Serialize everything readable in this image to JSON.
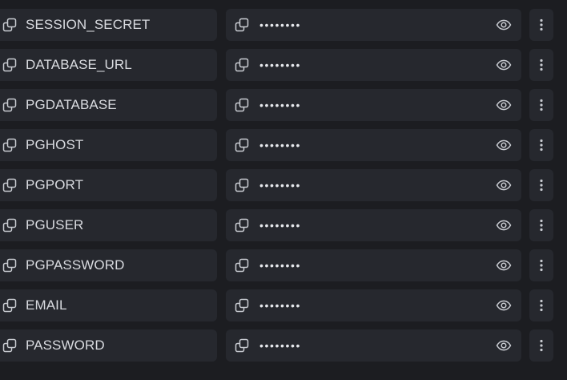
{
  "colors": {
    "background": "#1c1d21",
    "row_background": "#26282e",
    "text": "#d9dbe0",
    "icon": "#c9ccd2"
  },
  "icons": {
    "key_copy": "copy-icon",
    "value_copy": "copy-icon",
    "reveal": "eye-icon",
    "menu": "kebab-menu-icon"
  },
  "secrets": [
    {
      "key": "SESSION_SECRET",
      "value_mask": "••••••••"
    },
    {
      "key": "DATABASE_URL",
      "value_mask": "••••••••"
    },
    {
      "key": "PGDATABASE",
      "value_mask": "••••••••"
    },
    {
      "key": "PGHOST",
      "value_mask": "••••••••"
    },
    {
      "key": "PGPORT",
      "value_mask": "••••••••"
    },
    {
      "key": "PGUSER",
      "value_mask": "••••••••"
    },
    {
      "key": "PGPASSWORD",
      "value_mask": "••••••••"
    },
    {
      "key": "EMAIL",
      "value_mask": "••••••••"
    },
    {
      "key": "PASSWORD",
      "value_mask": "••••••••"
    }
  ]
}
